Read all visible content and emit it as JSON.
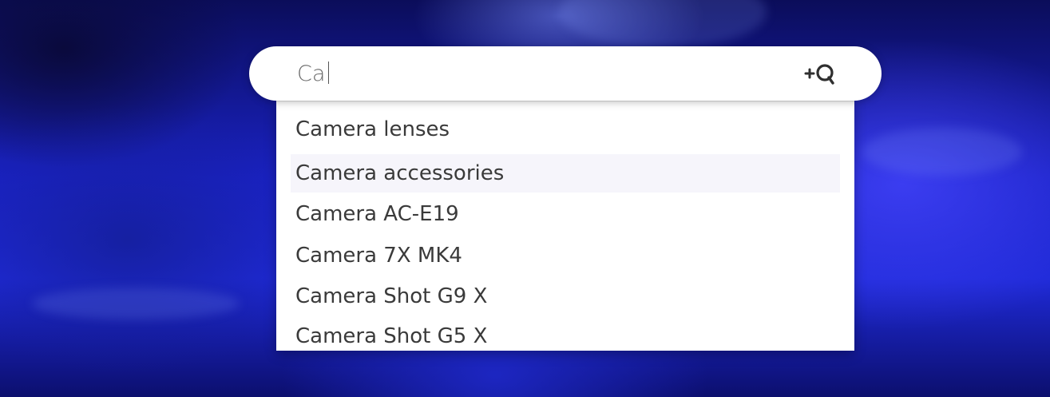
{
  "search": {
    "value": "Ca",
    "icon": "add-search-icon"
  },
  "suggestions": [
    {
      "label": "Camera lenses",
      "highlighted": false
    },
    {
      "label": "Camera accessories",
      "highlighted": true
    },
    {
      "label": "Camera AC-E19",
      "highlighted": false
    },
    {
      "label": "Camera 7X MK4",
      "highlighted": false
    },
    {
      "label": "Camera Shot G9 X",
      "highlighted": false
    },
    {
      "label": "Camera Shot G5 X",
      "highlighted": false
    }
  ],
  "colors": {
    "background": "#1a22c4",
    "text": "#3a3a3a",
    "highlight": "#f6f5fb"
  }
}
